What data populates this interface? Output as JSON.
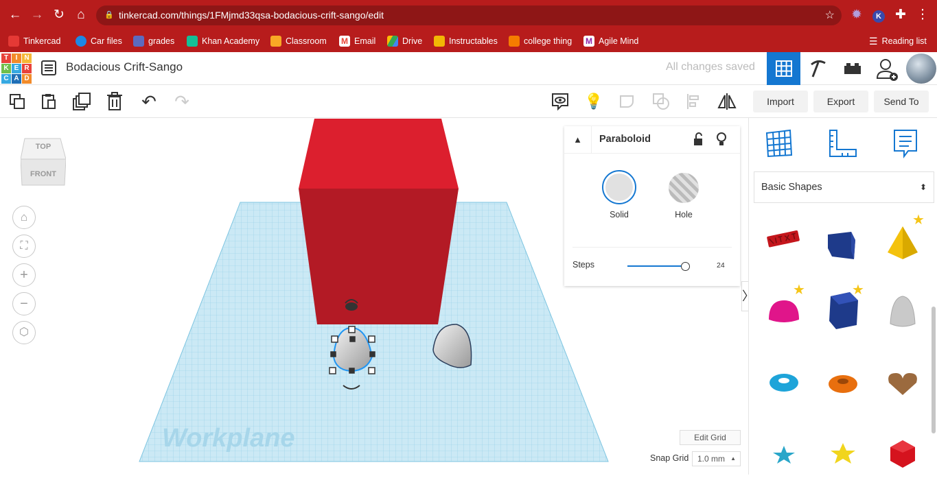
{
  "browser": {
    "url": "tinkercad.com/things/1FMjmd33qsa-bodacious-crift-sango/edit",
    "bookmarks": [
      {
        "label": "Tinkercad",
        "color": "#e53935"
      },
      {
        "label": "Car files",
        "color": "#1e88e5"
      },
      {
        "label": "grades",
        "color": "#5c6bc0"
      },
      {
        "label": "Khan Academy",
        "color": "#14bf96"
      },
      {
        "label": "Classroom",
        "color": "#f9a825"
      },
      {
        "label": "Email",
        "color": "#ea4335"
      },
      {
        "label": "Drive",
        "color": "#34a853"
      },
      {
        "label": "Instructables",
        "color": "#f2b705"
      },
      {
        "label": "college thing",
        "color": "#f57c00"
      },
      {
        "label": "Agile Mind",
        "color": "#8e24aa"
      }
    ],
    "reading_list": "Reading list"
  },
  "app": {
    "logo_letters": [
      "T",
      "I",
      "N",
      "K",
      "E",
      "R",
      "C",
      "A",
      "D"
    ],
    "design_title": "Bodacious Crift-Sango",
    "save_status": "All changes saved"
  },
  "toolbar": {
    "import": "Import",
    "export": "Export",
    "send_to": "Send To"
  },
  "viewcube": {
    "top": "TOP",
    "front": "FRONT"
  },
  "inspector": {
    "title": "Paraboloid",
    "solid": "Solid",
    "hole": "Hole",
    "steps_label": "Steps",
    "steps_value": "24",
    "steps_fraction": 0.96
  },
  "workplane": {
    "label": "Workplane",
    "edit_grid": "Edit Grid",
    "snap_grid_label": "Snap Grid",
    "snap_grid_value": "1.0 mm"
  },
  "panel": {
    "category": "Basic Shapes"
  },
  "colors": {
    "chrome": "#b71c1c",
    "accent": "#1477d1",
    "box": "#d81e2c",
    "grid": "#bfe3f2"
  }
}
